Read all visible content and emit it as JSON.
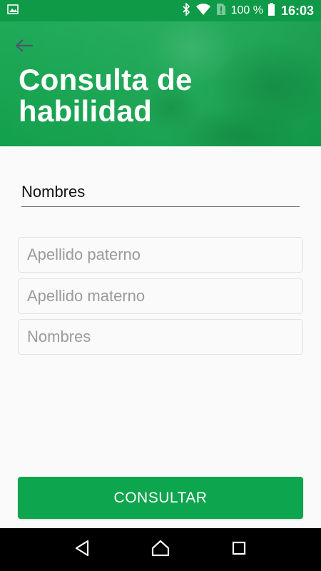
{
  "status_bar": {
    "battery_percent": "100 %",
    "time": "16:03",
    "icons": [
      "image-icon",
      "bluetooth-icon",
      "wifi-icon",
      "sim-alert-icon",
      "battery-icon"
    ]
  },
  "header": {
    "title": "Consulta de habilidad",
    "back_icon": "arrow-left-icon"
  },
  "form": {
    "names_value": "Nombres",
    "apellido_paterno_placeholder": "Apellido paterno",
    "apellido_materno_placeholder": "Apellido materno",
    "nombres_placeholder": "Nombres",
    "submit_label": "CONSULTAR"
  },
  "nav_bar": {
    "icons": [
      "back-triangle-icon",
      "home-icon",
      "recents-icon"
    ]
  },
  "colors": {
    "primary": "#0da54d",
    "status_bar": "#0e9a47",
    "nav_bar": "#000000"
  }
}
